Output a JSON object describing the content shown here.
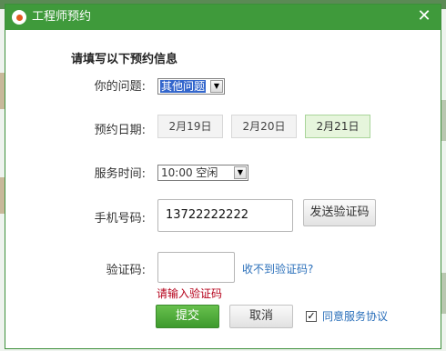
{
  "dialog": {
    "title": "工程师预约",
    "close_glyph": "✕",
    "heading": "请填写以下预约信息"
  },
  "form": {
    "question": {
      "label": "你的问题:",
      "selected": "其他问题"
    },
    "date": {
      "label": "预约日期:",
      "options": [
        "2月19日",
        "2月20日",
        "2月21日"
      ],
      "selected_index": 2
    },
    "time": {
      "label": "服务时间:",
      "selected": "10:00 空闲"
    },
    "phone": {
      "label": "手机号码:",
      "value": "13722222222",
      "send_button": "发送验证码"
    },
    "code": {
      "label": "验证码:",
      "value": "",
      "resend_link": "收不到验证码?",
      "error": "请输入验证码"
    }
  },
  "actions": {
    "submit": "提交",
    "cancel": "取消",
    "agree_checked": true,
    "agree_label": "同意服务协议",
    "check_glyph": "✓"
  },
  "colors": {
    "title_bar": "#3f9a3b",
    "submit": "#4fae3a",
    "selected_date": "#e6f5dc",
    "link": "#2a6fba",
    "error": "#b5001a"
  }
}
